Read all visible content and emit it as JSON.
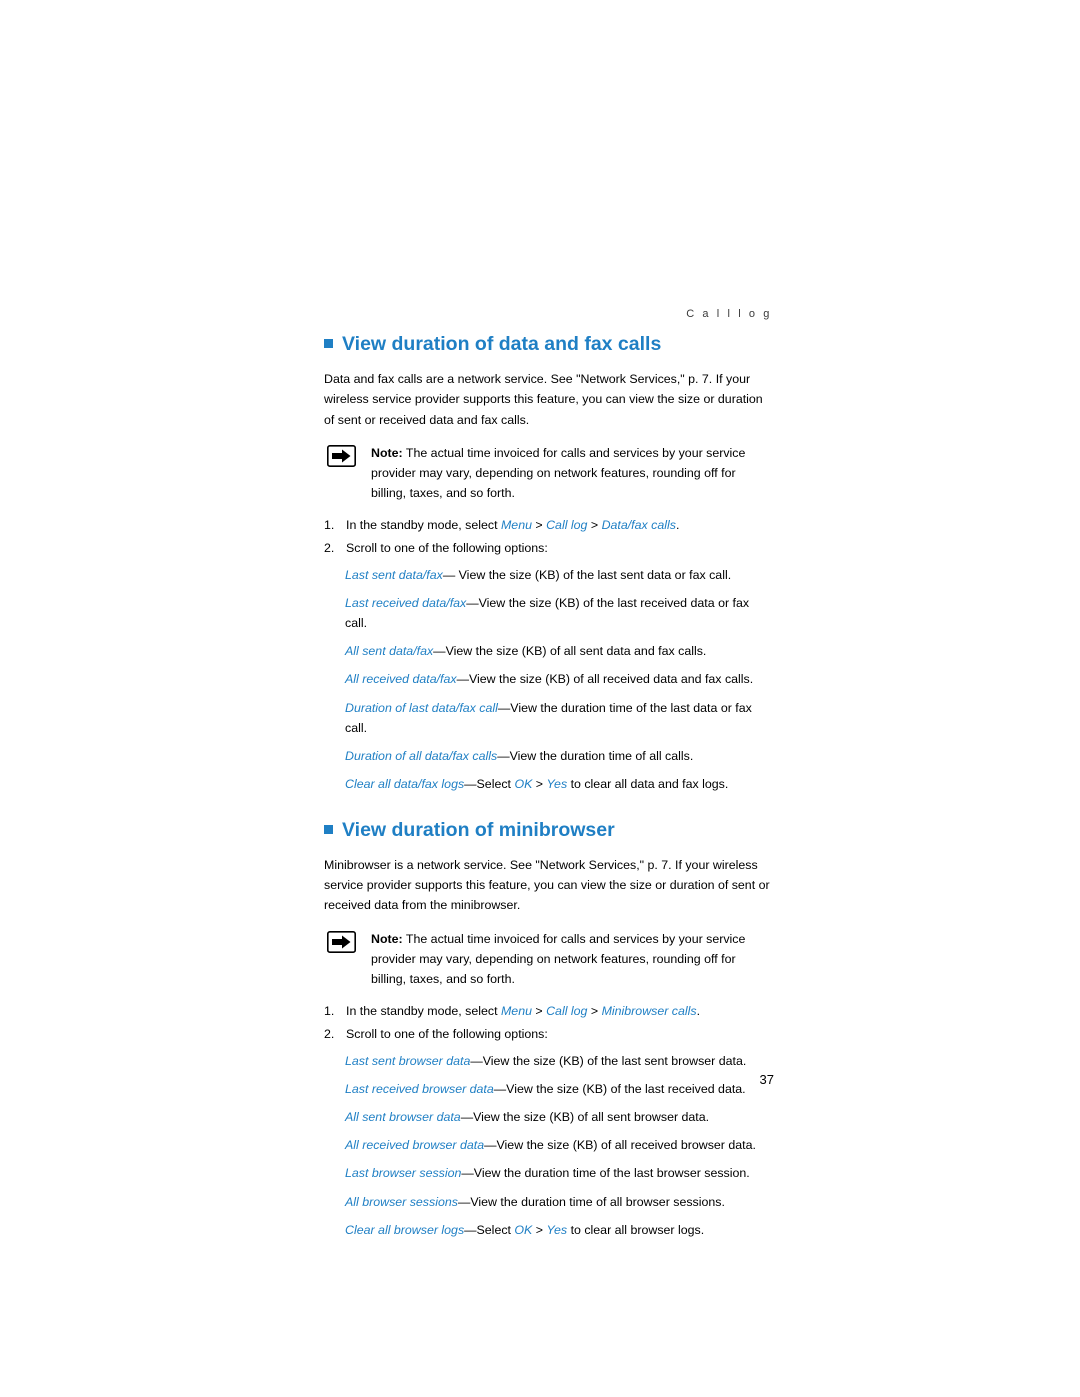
{
  "header": {
    "running_head": "C a l l   l o g"
  },
  "page_number": "37",
  "sections": [
    {
      "title": "View duration of data and fax calls",
      "intro": "Data and fax calls are a network service. See \"Network Services,\" p. 7. If your wireless service provider supports this feature, you can view the size or duration of sent or received data and fax calls.",
      "note": {
        "label": "Note:",
        "text": " The actual time invoiced for calls and services by your service provider may vary, depending on network features, rounding off for billing, taxes, and so forth."
      },
      "steps": [
        {
          "num": "1.",
          "pre": "In the standby mode, select ",
          "path": [
            "Menu",
            "Call log",
            "Data/fax calls"
          ],
          "post": "."
        },
        {
          "num": "2.",
          "pre": "Scroll to one of the following options:",
          "path": [],
          "post": ""
        }
      ],
      "options": [
        {
          "term": "Last sent data/fax",
          "desc": "— View the size (KB) of the last sent data or fax call."
        },
        {
          "term": "Last received data/fax",
          "desc": "—View the size (KB) of the last received data or fax call."
        },
        {
          "term": "All sent data/fax",
          "desc": "—View the size (KB) of all sent data and fax calls."
        },
        {
          "term": "All received data/fax",
          "desc": "—View the size (KB) of all received data and fax calls."
        },
        {
          "term": "Duration of last data/fax call",
          "desc": "—View the duration time of the last data or fax call."
        },
        {
          "term": "Duration of all data/fax calls",
          "desc": "—View the duration time of all calls."
        },
        {
          "term": "Clear all data/fax logs",
          "desc_pre": "—Select ",
          "link1": "OK",
          "mid": " > ",
          "link2": "Yes",
          "desc_post": " to clear all data and fax logs."
        }
      ]
    },
    {
      "title": "View duration of minibrowser",
      "intro": "Minibrowser is a network service. See \"Network Services,\" p. 7. If your wireless service provider supports this feature, you can view the size or duration of sent or received data from the minibrowser.",
      "note": {
        "label": "Note:",
        "text": " The actual time invoiced for calls and services by your service provider may vary, depending on network features, rounding off for billing, taxes, and so forth."
      },
      "steps": [
        {
          "num": "1.",
          "pre": "In the standby mode, select ",
          "path": [
            "Menu",
            "Call log",
            "Minibrowser calls"
          ],
          "post": "."
        },
        {
          "num": "2.",
          "pre": "Scroll to one of the following options:",
          "path": [],
          "post": ""
        }
      ],
      "options": [
        {
          "term": "Last sent browser data",
          "desc": "—View the size (KB) of the last sent browser data."
        },
        {
          "term": "Last received browser data",
          "desc": "—View the size (KB) of the last received data."
        },
        {
          "term": "All sent browser data",
          "desc": "—View the size (KB) of all sent browser data."
        },
        {
          "term": "All received browser data",
          "desc": "—View the size (KB) of all received browser data."
        },
        {
          "term": "Last browser session",
          "desc": "—View the duration time of the last browser session."
        },
        {
          "term": "All browser sessions",
          "desc": "—View the duration time of all browser sessions."
        },
        {
          "term": "Clear all browser logs",
          "desc_pre": "—Select ",
          "link1": "OK",
          "mid": " > ",
          "link2": "Yes",
          "desc_post": " to clear all browser logs."
        }
      ]
    }
  ],
  "colors": {
    "accent": "#1f7fc4",
    "text": "#000000"
  },
  "icons": {
    "note": "note-pointer-icon",
    "bullet": "square-bullet-icon"
  }
}
